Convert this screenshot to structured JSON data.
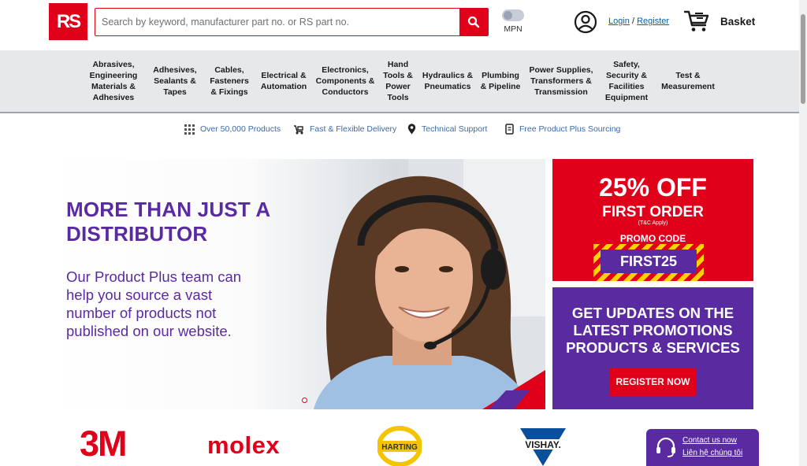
{
  "header": {
    "logo_text": "RS",
    "search_placeholder": "Search by keyword, manufacturer part no. or RS part no.",
    "mpn_label": "MPN",
    "login": "Login",
    "separator": "/",
    "register": "Register",
    "basket": "Basket"
  },
  "categories": [
    "Abrasives,\nEngineering\nMaterials &\nAdhesives",
    "Adhesives,\nSealants &\nTapes",
    "Cables,\nFasteners\n& Fixings",
    "Electrical &\nAutomation",
    "Electronics,\nComponents &\nConductors",
    "Hand\nTools &\nPower\nTools",
    "Hydraulics &\nPneumatics",
    "Plumbing\n& Pipeline",
    "Power Supplies,\nTransformers &\nTransmission",
    "Safety,\nSecurity &\nFacilities\nEquipment",
    "Test &\nMeasurement"
  ],
  "usps": [
    {
      "label": "Over 50,000 Products",
      "icon": "grid-icon"
    },
    {
      "label": "Fast & Flexible Delivery",
      "icon": "delivery-icon"
    },
    {
      "label": "Technical Support",
      "icon": "location-pin-icon"
    },
    {
      "label": "Free Product Plus Sourcing",
      "icon": "sourcing-icon"
    }
  ],
  "hero": {
    "headline": "MORE THAN JUST A DISTRIBUTOR",
    "body": "Our Product Plus team can help you source a vast number of products not published on our website."
  },
  "promo": {
    "headline": "25% OFF",
    "subheadline": "FIRST ORDER",
    "terms": "(T&C Apply)",
    "code_label": "PROMO CODE",
    "code": "FIRST25"
  },
  "updates": {
    "text": "GET UPDATES ON THE\nLATEST PROMOTIONS\nPRODUCTS & SERVICES",
    "button": "REGISTER NOW"
  },
  "brands": {
    "b1": "3M",
    "b2": "molex",
    "b3": "HARTING",
    "b4": "VISHAY."
  },
  "contact": {
    "line1": "Contact us now",
    "line2": "Liên hệ chúng tôi"
  },
  "colors": {
    "brand_red": "#e0001a",
    "brand_purple": "#5a2aa0",
    "link_blue": "#0a5eb0"
  }
}
